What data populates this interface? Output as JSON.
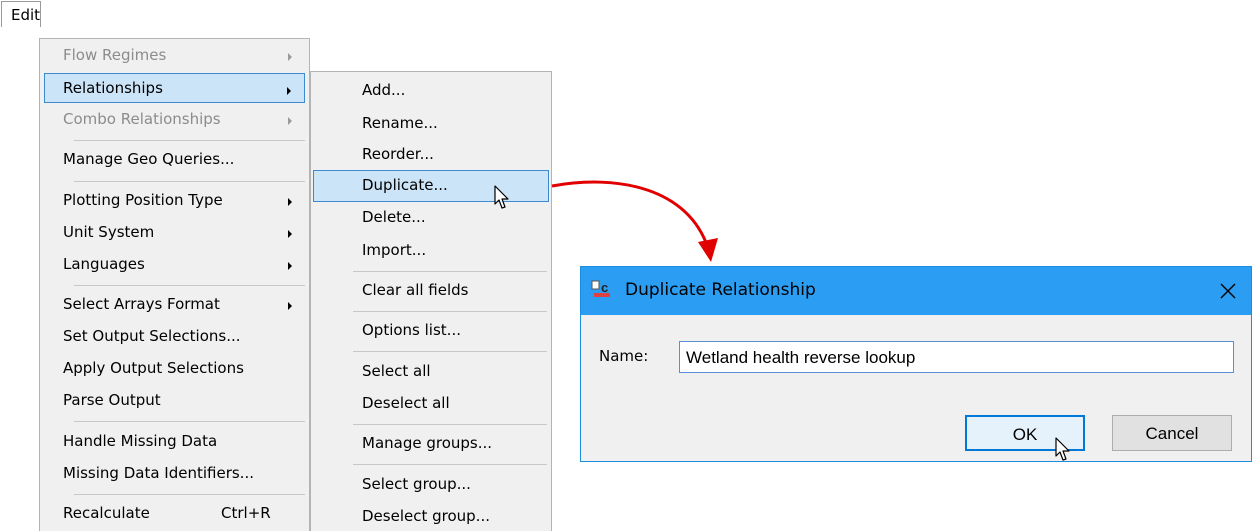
{
  "menubar": {
    "edit": "Edit"
  },
  "main_menu": {
    "items": [
      {
        "label": "Flow Regimes"
      },
      {
        "label": "Relationships"
      },
      {
        "label": "Combo Relationships"
      },
      {
        "label": "Manage Geo Queries..."
      },
      {
        "label": "Plotting Position Type"
      },
      {
        "label": "Unit System"
      },
      {
        "label": "Languages"
      },
      {
        "label": "Select Arrays Format"
      },
      {
        "label": "Set Output Selections..."
      },
      {
        "label": "Apply Output Selections"
      },
      {
        "label": "Parse Output"
      },
      {
        "label": "Handle Missing Data"
      },
      {
        "label": "Missing Data Identifiers..."
      },
      {
        "label": "Recalculate",
        "shortcut": "Ctrl+R"
      }
    ]
  },
  "sub_menu": {
    "items": [
      {
        "label": "Add..."
      },
      {
        "label": "Rename..."
      },
      {
        "label": "Reorder..."
      },
      {
        "label": "Duplicate..."
      },
      {
        "label": "Delete..."
      },
      {
        "label": "Import..."
      },
      {
        "label": "Clear all fields"
      },
      {
        "label": "Options list..."
      },
      {
        "label": "Select all"
      },
      {
        "label": "Deselect all"
      },
      {
        "label": "Manage groups..."
      },
      {
        "label": "Select group..."
      },
      {
        "label": "Deselect group..."
      }
    ]
  },
  "dialog": {
    "title": "Duplicate Relationship",
    "name_label": "Name:",
    "name_value": "Wetland health reverse lookup",
    "ok_label": "OK",
    "cancel_label": "Cancel"
  },
  "colors": {
    "highlight_bg": "#cce4f7",
    "highlight_border": "#3d8ad1",
    "titlebar": "#2b9df2",
    "arrow": "#e00000"
  }
}
